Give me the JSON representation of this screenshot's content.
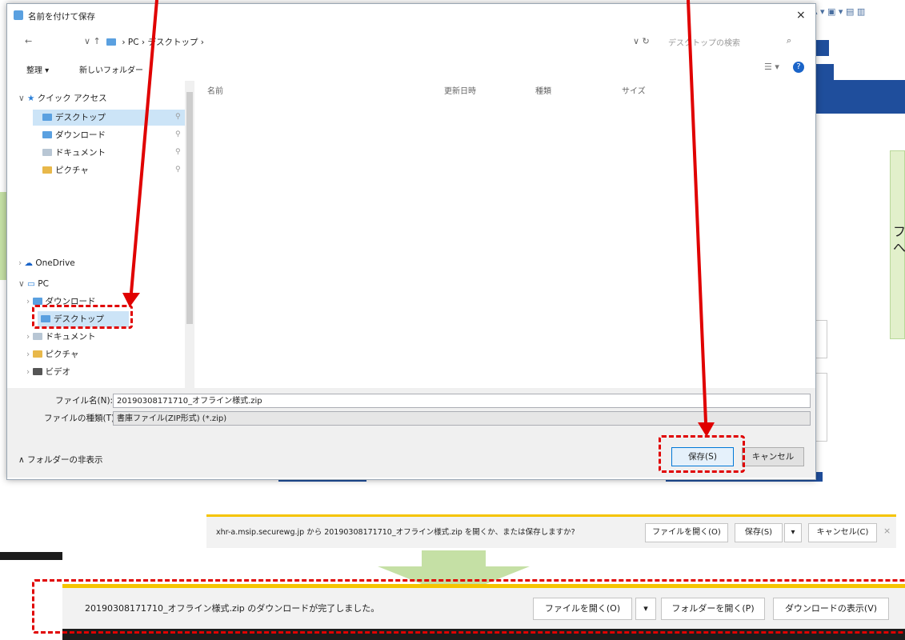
{
  "dialog": {
    "title": "名前を付けて保存",
    "close_glyph": "×",
    "breadcrumb": [
      "PC",
      "デスクトップ"
    ],
    "search_placeholder": "デスクトップの検索",
    "organize_label": "整理 ▾",
    "new_folder_label": "新しいフォルダー",
    "columns": [
      "名前",
      "更新日時",
      "種類",
      "サイズ"
    ],
    "nav": {
      "quick_access": "クイック アクセス",
      "quick_items": [
        "デスクトップ",
        "ダウンロード",
        "ドキュメント",
        "ピクチャ"
      ],
      "onedrive": "OneDrive",
      "pc": "PC",
      "pc_items": [
        "ダウンロード",
        "デスクトップ",
        "ドキュメント",
        "ピクチャ",
        "ビデオ"
      ]
    },
    "filename_label": "ファイル名(N):",
    "filename_value": "20190308171710_オフライン様式.zip",
    "filetype_label": "ファイルの種類(T):",
    "filetype_value": "書庫ファイル(ZIP形式) (*.zip)",
    "hide_folders_label": "∧ フォルダーの非表示",
    "save_button": "保存(S)",
    "cancel_button": "キャンセル"
  },
  "background": {
    "callout_text_1": "フ",
    "callout_text_2": "へ"
  },
  "download_prompt": {
    "message": "xhr-a.msip.securewg.jp から 20190308171710_オフライン様式.zip を開くか、または保存しますか?",
    "open_button": "ファイルを開く(O)",
    "save_button": "保存(S)",
    "dropdown": "▾",
    "cancel_button": "キャンセル(C)",
    "close": "×"
  },
  "download_complete": {
    "message": "20190308171710_オフライン様式.zip のダウンロードが完了しました。",
    "open_file_button": "ファイルを開く(O)",
    "dropdown": "▾",
    "open_folder_button": "フォルダーを開く(P)",
    "view_downloads_button": "ダウンロードの表示(V)"
  },
  "colors": {
    "highlight": "#e00000",
    "accent_blue": "#1f4e9c",
    "notification_bar": "#f5c400",
    "callout_green": "#e2f0cb",
    "arrow_green": "#c5e0a5"
  }
}
